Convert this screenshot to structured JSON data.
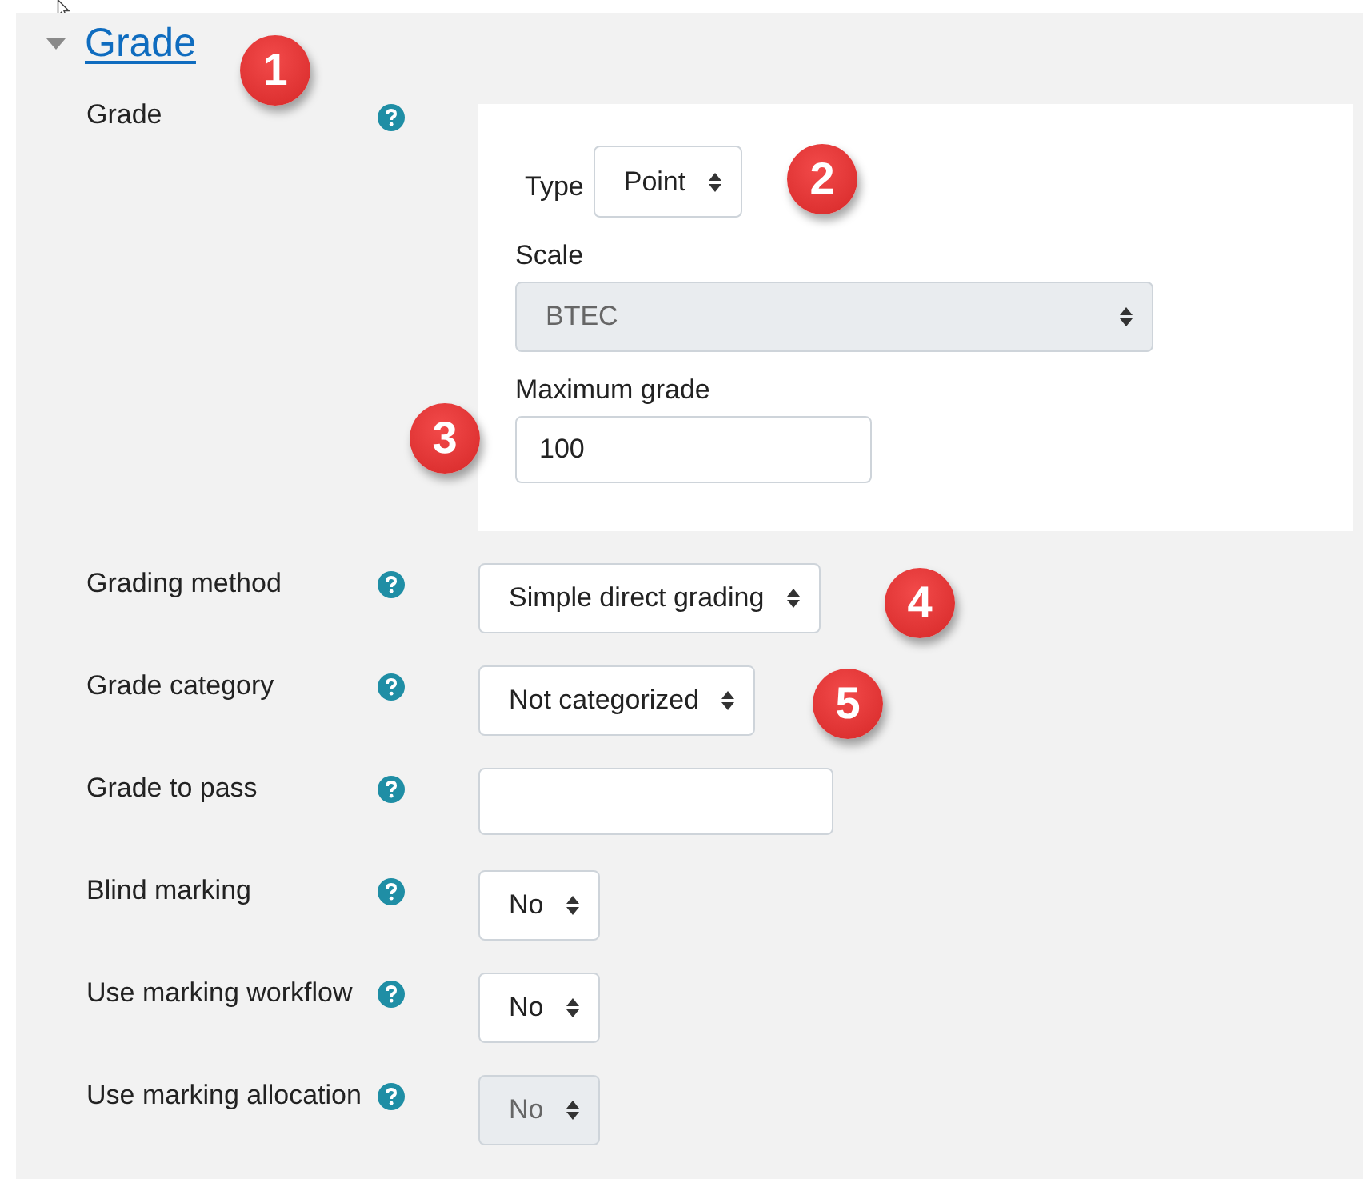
{
  "section": {
    "title": "Grade",
    "expanded": true
  },
  "grade_group": {
    "label": "Grade",
    "type": {
      "label": "Type",
      "value": "Point"
    },
    "scale": {
      "label": "Scale",
      "value": "BTEC",
      "disabled": true
    },
    "maximum_grade": {
      "label": "Maximum grade",
      "value": "100"
    }
  },
  "fields": [
    {
      "label": "Grading method",
      "kind": "select",
      "value": "Simple direct grading",
      "disabled": false
    },
    {
      "label": "Grade category",
      "kind": "select",
      "value": "Not categorized",
      "disabled": false
    },
    {
      "label": "Grade to pass",
      "kind": "text",
      "disabled": false
    },
    {
      "label": "Blind marking",
      "kind": "select",
      "value": "No",
      "disabled": false
    },
    {
      "label": "Use marking workflow",
      "kind": "select",
      "value": "No",
      "disabled": false
    },
    {
      "label": "Use marking allocation",
      "kind": "select",
      "value": "No",
      "disabled": true
    }
  ],
  "callouts": [
    "1",
    "2",
    "3",
    "4",
    "5"
  ]
}
